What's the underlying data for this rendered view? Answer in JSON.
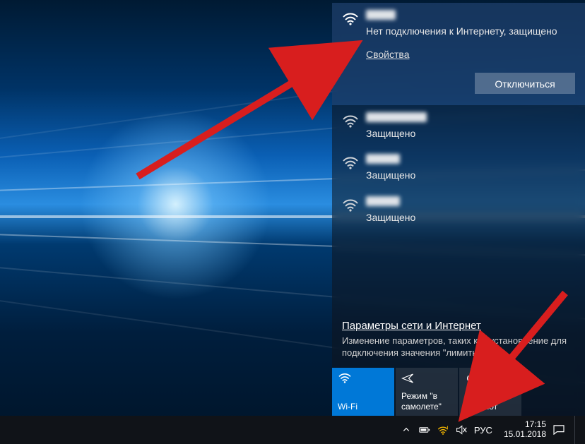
{
  "current": {
    "status": "Нет подключения к Интернету, защищено",
    "properties_label": "Свойства",
    "disconnect_label": "Отключиться"
  },
  "others": [
    {
      "status": "Защищено"
    },
    {
      "status": "Защищено"
    },
    {
      "status": "Защищено"
    }
  ],
  "settings": {
    "link": "Параметры сети и Интернет",
    "caption": "Изменение параметров, таких как установление для подключения значения \"лимитное\"."
  },
  "tiles": {
    "wifi": "Wi-Fi",
    "airplane": "Режим \"в самолете\"",
    "hotspot": "Мобильный хот-спот"
  },
  "tray": {
    "lang": "РУС",
    "time": "17:15",
    "date": "15.01.2018"
  }
}
